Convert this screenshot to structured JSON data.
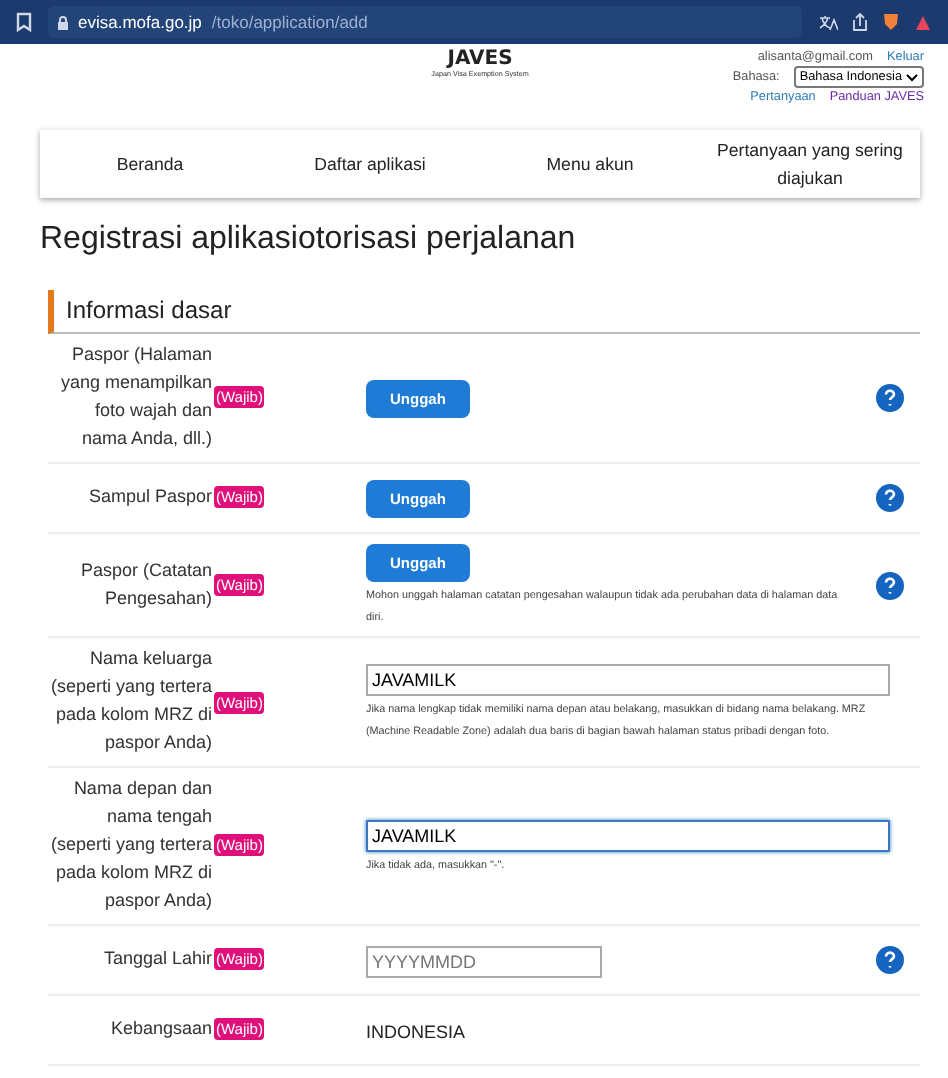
{
  "browser": {
    "url_host": "evisa.mofa.go.jp",
    "url_path": "/toko/application/add"
  },
  "header": {
    "logo": "JAVES",
    "subtitle": "Japan Visa Exemption System",
    "email": "alisanta@gmail.com",
    "logout": "Keluar",
    "language_label": "Bahasa:",
    "language_value": "Bahasa Indonesia",
    "links": [
      "Pertanyaan",
      "Panduan JAVES"
    ]
  },
  "nav": [
    "Beranda",
    "Daftar aplikasi",
    "Menu akun",
    "Pertanyaan yang sering diajukan"
  ],
  "page_title": "Registrasi aplikasiotorisasi perjalanan",
  "section_title": "Informasi dasar",
  "rows": [
    {
      "kind": "upload",
      "label": "Paspor (Halaman yang menampilkan foto wajah dan nama Anda, dll.)",
      "badge": "(Wajib)",
      "button": "Unggah",
      "help": true
    },
    {
      "kind": "upload",
      "label": "Sampul Paspor",
      "badge": "(Wajib)",
      "button": "Unggah",
      "help": true
    },
    {
      "kind": "upload",
      "label": "Paspor (Catatan Pengesahan)",
      "badge": "(Wajib)",
      "button": "Unggah",
      "note": "Mohon unggah halaman catatan pengesahan walaupun tidak ada perubahan data di halaman data diri.",
      "help": true
    },
    {
      "kind": "text",
      "label": "Nama keluarga (seperti yang tertera pada kolom MRZ di paspor Anda)",
      "badge": "(Wajib)",
      "value": "JAVAMILK",
      "focused": false,
      "note": "Jika nama lengkap tidak memiliki nama depan atau belakang, masukkan di bidang nama belakang. MRZ (Machine Readable Zone) adalah dua baris di bagian bawah halaman status pribadi dengan foto.",
      "help": false
    },
    {
      "kind": "text",
      "label": "Nama depan dan nama tengah (seperti yang tertera pada kolom MRZ di paspor Anda)",
      "badge": "(Wajib)",
      "value": "JAVAMILK",
      "focused": true,
      "note": "Jika tidak ada, masukkan \"-\".",
      "help": false
    },
    {
      "kind": "date",
      "label": "Tanggal Lahir",
      "badge": "(Wajib)",
      "placeholder": "YYYYMMDD",
      "help": true
    },
    {
      "kind": "static",
      "label": "Kebangsaan",
      "badge": "(Wajib)",
      "value": "INDONESIA",
      "help": false
    }
  ]
}
